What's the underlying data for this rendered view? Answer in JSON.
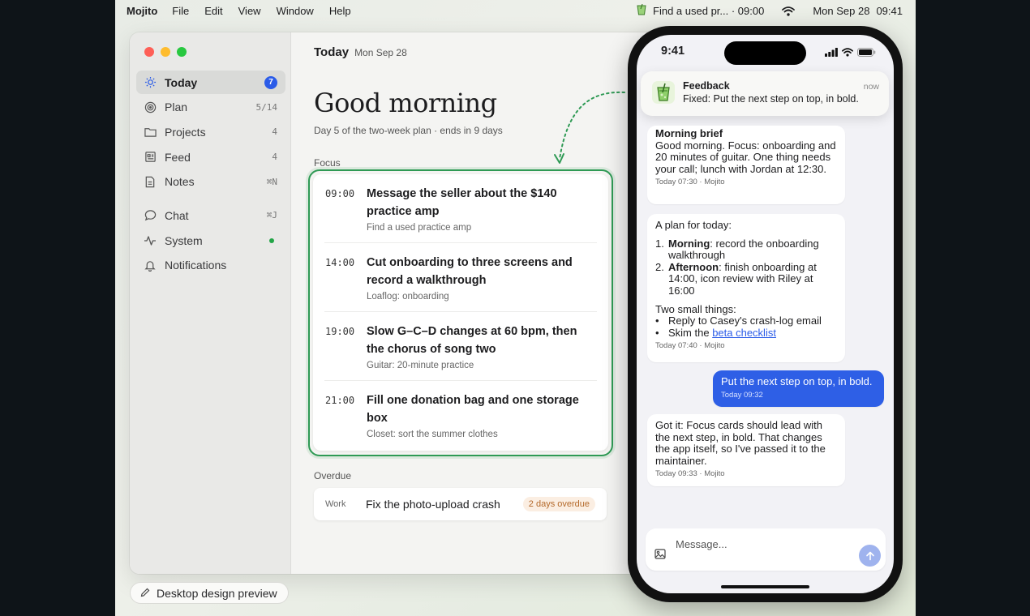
{
  "menubar": {
    "app_name": "Mojito",
    "items": [
      "File",
      "Edit",
      "View",
      "Window",
      "Help"
    ],
    "status_task": "Find a used pr... · 09:00",
    "date": "Mon Sep 28",
    "time": "09:41"
  },
  "sidebar": {
    "items": [
      {
        "label": "Today",
        "badge": "7",
        "icon": "sun-icon"
      },
      {
        "label": "Plan",
        "meta": "5/14",
        "icon": "target-icon"
      },
      {
        "label": "Projects",
        "meta": "4",
        "icon": "folder-icon"
      },
      {
        "label": "Feed",
        "meta": "4",
        "icon": "newspaper-icon"
      },
      {
        "label": "Notes",
        "meta": "⌘N",
        "icon": "note-icon"
      },
      {
        "label": "Chat",
        "meta": "⌘J",
        "icon": "chat-bubble-icon"
      },
      {
        "label": "System",
        "icon": "pulse-icon"
      },
      {
        "label": "Notifications",
        "icon": "bell-icon"
      }
    ]
  },
  "main": {
    "title": "Today",
    "date": "Mon Sep 28",
    "greeting": "Good morning",
    "subline": "Day 5 of the two-week plan · ends in 9 days",
    "focus_label": "Focus",
    "focus": [
      {
        "time": "09:00",
        "title": "Message the seller about the $140 practice amp",
        "sub": "Find a used practice amp"
      },
      {
        "time": "14:00",
        "title": "Cut onboarding to three screens and record a walkthrough",
        "sub": "Loaflog: onboarding"
      },
      {
        "time": "19:00",
        "title": "Slow G–C–D changes at 60 bpm, then the chorus of song two",
        "sub": "Guitar: 20-minute practice"
      },
      {
        "time": "21:00",
        "title": "Fill one donation bag and one storage box",
        "sub": "Closet: sort the summer clothes"
      }
    ],
    "overdue_label": "Overdue",
    "overdue": {
      "category": "Work",
      "title": "Fix the photo-upload crash",
      "status": "2 days overdue"
    }
  },
  "preview_pill": "Desktop design preview",
  "phone": {
    "time": "9:41",
    "notification": {
      "title": "Feedback",
      "body": "Fixed: Put the next step on top, in bold.",
      "time": "now"
    },
    "messages": {
      "brief_title": "Morning brief",
      "brief_body": "Good morning. Focus: onboarding and 20 minutes of guitar. One thing needs your call; lunch with Jordan at 12:30.",
      "brief_meta": "Today 07:30 · Mojito",
      "plan_intro": "A plan for today:",
      "plan_items": [
        {
          "num": "1.",
          "bold": "Morning",
          "rest": ": record the onboarding walkthrough"
        },
        {
          "num": "2.",
          "bold": "Afternoon",
          "rest": ": finish onboarding at 14:00, icon review with Riley at 16:00"
        }
      ],
      "small_things": "Two small things:",
      "bullet1": "Reply to Casey's crash-log email",
      "bullet2_prefix": "Skim the ",
      "bullet2_link": "beta checklist",
      "plan_meta": "Today 07:40 · Mojito",
      "user_text": "Put the next step on top, in bold.",
      "user_meta": "Today 09:32",
      "reply_text": "Got it: Focus cards should lead with the next step, in bold. That changes the app itself, so I've passed it to the maintainer.",
      "reply_meta": "Today 09:33 · Mojito"
    },
    "composer_placeholder": "Message..."
  },
  "colors": {
    "accent": "#2b5ce8",
    "focus_border": "#2f9a55",
    "overdue": "#b4692a"
  }
}
